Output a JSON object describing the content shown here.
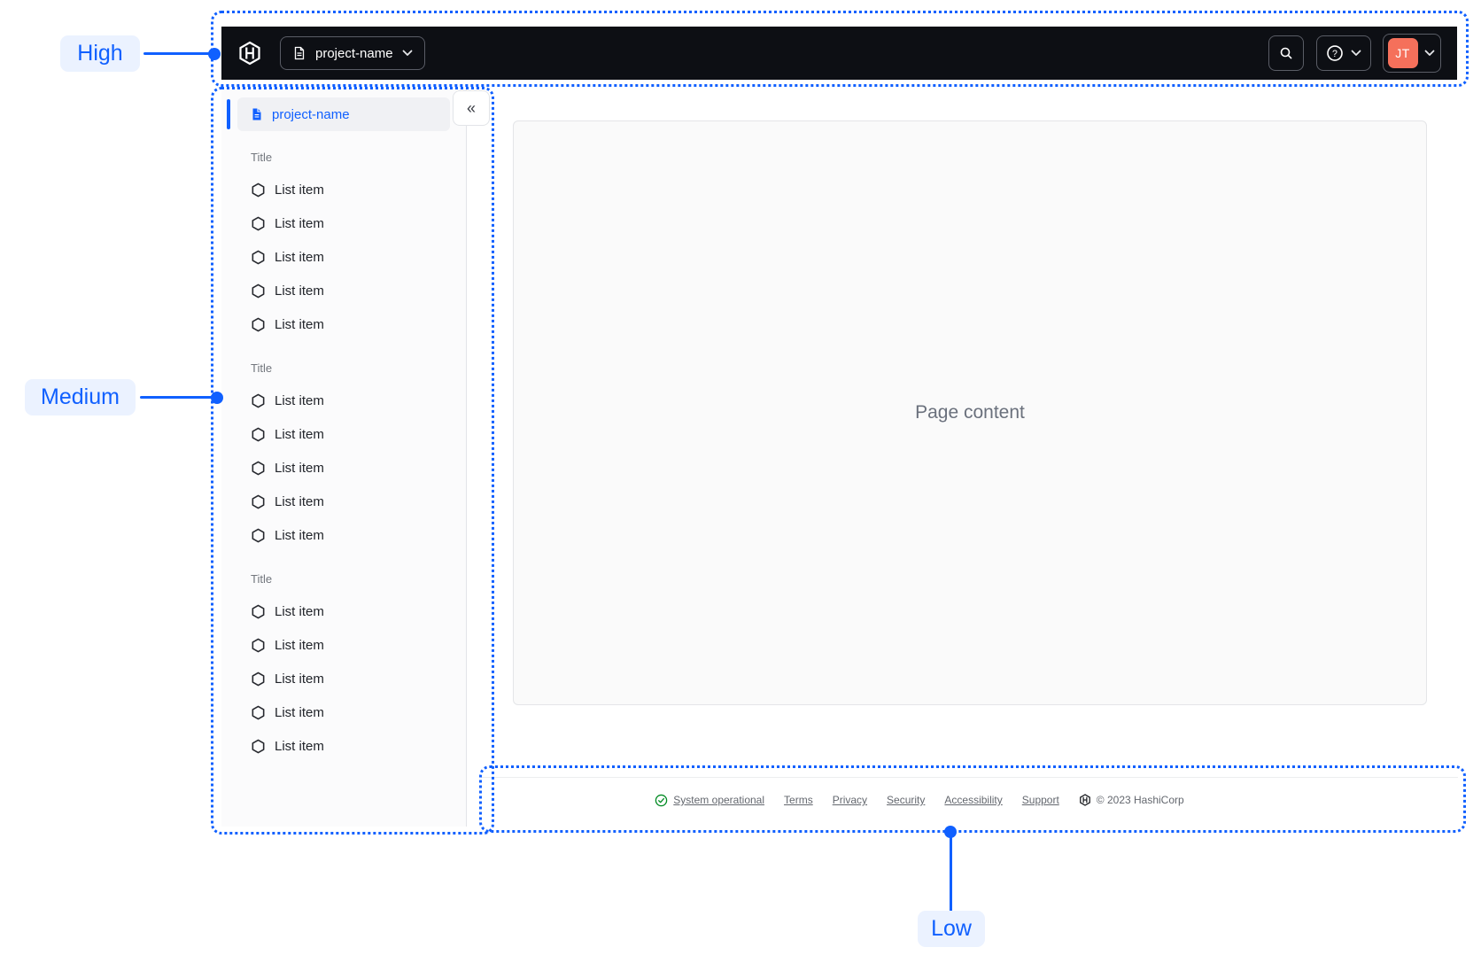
{
  "colors": {
    "annotation_blue": "#1060FF",
    "annotation_pill_bg": "#EBF2FF",
    "navbar_bg": "#0D0F14",
    "navbar_border": "#5A5D66",
    "avatar_bg": "#F5705B",
    "accent_blue": "#1060FF",
    "status_green": "#008A22",
    "panel_bg": "#FBFBFC",
    "panel_border": "#E2E4E8",
    "content_bg": "#FAFAFA",
    "content_border": "#E4E5E8"
  },
  "annotations": {
    "high": "High",
    "medium": "Medium",
    "low": "Low"
  },
  "navbar": {
    "logo_icon": "hashicorp-logo",
    "project_switcher_label": "project-name",
    "project_switcher_icon": "document-icon",
    "search_icon": "magnifier-icon",
    "help_icon": "question-circle-icon",
    "user_initials": "JT"
  },
  "sidebar": {
    "active_item_label": "project-name",
    "active_item_icon": "document-icon",
    "collapse_glyph": "«",
    "sections": [
      {
        "title": "Title",
        "items": [
          "List item",
          "List item",
          "List item",
          "List item",
          "List item"
        ]
      },
      {
        "title": "Title",
        "items": [
          "List item",
          "List item",
          "List item",
          "List item",
          "List item"
        ]
      },
      {
        "title": "Title",
        "items": [
          "List item",
          "List item",
          "List item",
          "List item",
          "List item"
        ]
      }
    ]
  },
  "main": {
    "placeholder": "Page content"
  },
  "footer": {
    "status_label": "System operational",
    "links": [
      "Terms",
      "Privacy",
      "Security",
      "Accessibility",
      "Support"
    ],
    "copyright": "© 2023 HashiCorp"
  }
}
